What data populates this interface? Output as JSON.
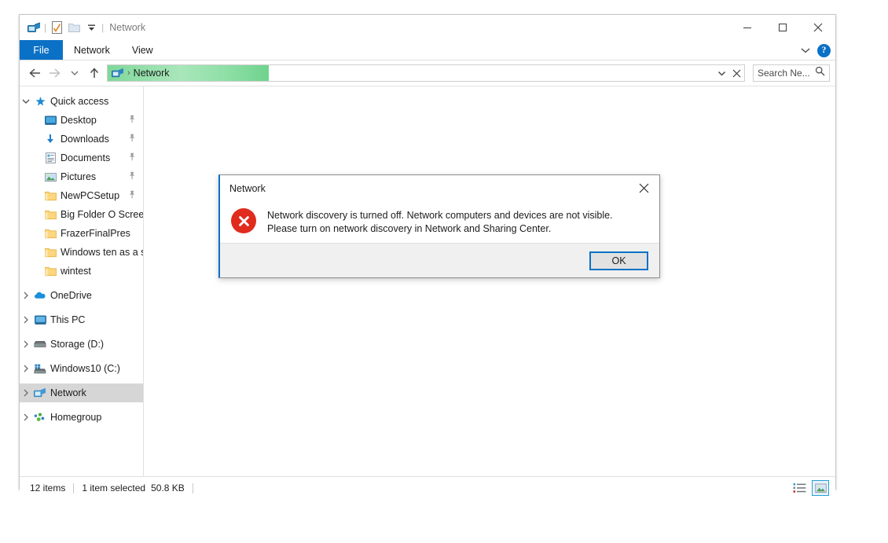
{
  "window": {
    "title": "Network",
    "quick_access_toolbar": [
      {
        "name": "network-properties-icon",
        "label": "Network"
      },
      {
        "name": "properties-icon",
        "label": "Properties"
      },
      {
        "name": "new-folder-icon",
        "label": "New folder"
      },
      {
        "name": "customize-qat-chevron-icon",
        "label": "Customize Quick Access Toolbar"
      }
    ],
    "controls": {
      "minimize": "Minimize",
      "maximize": "Maximize",
      "close": "Close",
      "ribbon_collapse": "Minimize the Ribbon",
      "help": "?"
    }
  },
  "ribbon": {
    "tabs": [
      {
        "label": "File",
        "active": true
      },
      {
        "label": "Network",
        "active": false
      },
      {
        "label": "View",
        "active": false
      }
    ]
  },
  "address": {
    "back": "Back",
    "forward": "Forward",
    "recent": "Recent locations",
    "up": "Up",
    "crumb_icon": "network-icon",
    "crumb_separator": "›",
    "path": "Network",
    "dropdown": "Previous locations",
    "stop": "Stop",
    "progress_percent": 24
  },
  "search": {
    "placeholder": "Search Ne...",
    "value": "",
    "icon": "search-icon"
  },
  "sidebar": {
    "groups": [
      {
        "header": {
          "label": "Quick access",
          "icon": "star-pin-icon",
          "expanded": true
        },
        "items": [
          {
            "label": "Desktop",
            "icon": "desktop-icon",
            "pinned": true
          },
          {
            "label": "Downloads",
            "icon": "downloads-icon",
            "pinned": true
          },
          {
            "label": "Documents",
            "icon": "documents-icon",
            "pinned": true
          },
          {
            "label": "Pictures",
            "icon": "pictures-icon",
            "pinned": true
          },
          {
            "label": "NewPCSetup",
            "icon": "folder-icon",
            "pinned": true
          },
          {
            "label": "Big Folder O Screen",
            "icon": "folder-icon",
            "pinned": false
          },
          {
            "label": "FrazerFinalPres",
            "icon": "folder-icon",
            "pinned": false
          },
          {
            "label": "Windows ten as  a s",
            "icon": "folder-icon",
            "pinned": false
          },
          {
            "label": "wintest",
            "icon": "folder-icon",
            "pinned": false
          }
        ]
      }
    ],
    "roots": [
      {
        "label": "OneDrive",
        "icon": "onedrive-icon",
        "selected": false
      },
      {
        "label": "This PC",
        "icon": "thispc-icon",
        "selected": false
      },
      {
        "label": "Storage (D:)",
        "icon": "drive-icon",
        "selected": false
      },
      {
        "label": "Windows10 (C:)",
        "icon": "windows-drive-icon",
        "selected": false
      },
      {
        "label": "Network",
        "icon": "network-icon",
        "selected": true
      },
      {
        "label": "Homegroup",
        "icon": "homegroup-icon",
        "selected": false
      }
    ]
  },
  "status": {
    "items_count": "12 items",
    "selection": "1 item selected",
    "selection_size": "50.8 KB",
    "views": [
      {
        "name": "details-view-button",
        "label": "Details view",
        "active": false
      },
      {
        "name": "large-icons-view-button",
        "label": "Large icons view",
        "active": true
      }
    ]
  },
  "dialog": {
    "title": "Network",
    "close_label": "Close",
    "icon": "error-icon",
    "message": "Network discovery is turned off. Network computers and devices are not visible. Please turn on network discovery in Network and Sharing Center.",
    "ok_label": "OK"
  },
  "colors": {
    "accent": "#0b71c6",
    "error": "#e02b1d",
    "progress_green": "#7fd89a",
    "selection_gray": "#d6d6d6"
  }
}
